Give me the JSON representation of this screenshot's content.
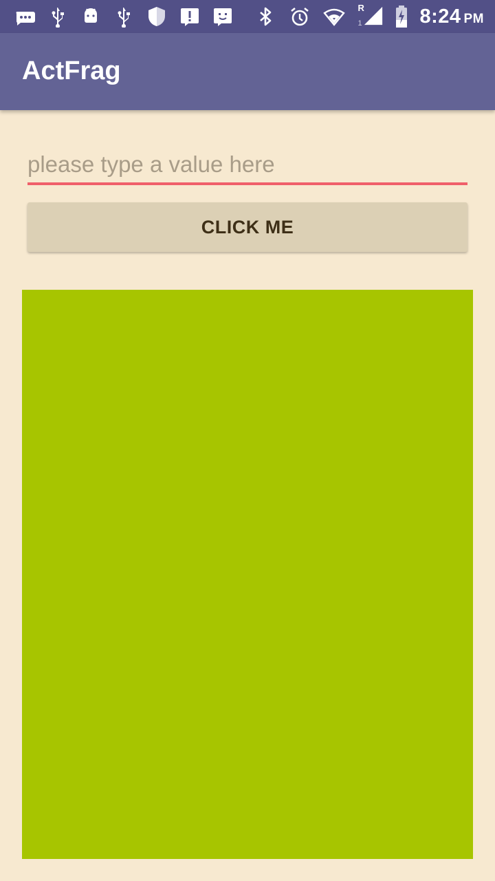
{
  "status_bar": {
    "left_icons": [
      "chat-bubble-icon",
      "usb-icon",
      "android-icon",
      "usb-icon",
      "shield-icon",
      "alert-icon",
      "screen-face-icon"
    ],
    "right_icons": [
      "bluetooth-icon",
      "alarm-icon",
      "wifi-icon",
      "cell-signal-icon",
      "battery-charging-icon"
    ],
    "signal_label": "R",
    "sim_label": "1",
    "time": "8:24",
    "ampm": "PM"
  },
  "app_bar": {
    "title": "ActFrag",
    "color": "#636395"
  },
  "form": {
    "input_value": "",
    "input_placeholder": "please type a value here",
    "underline_color": "#ef5f6a",
    "button_label": "CLICK ME"
  },
  "fragment": {
    "color": "#a7c500"
  },
  "colors": {
    "background": "#f7e9d0",
    "status_bar": "#525087"
  }
}
